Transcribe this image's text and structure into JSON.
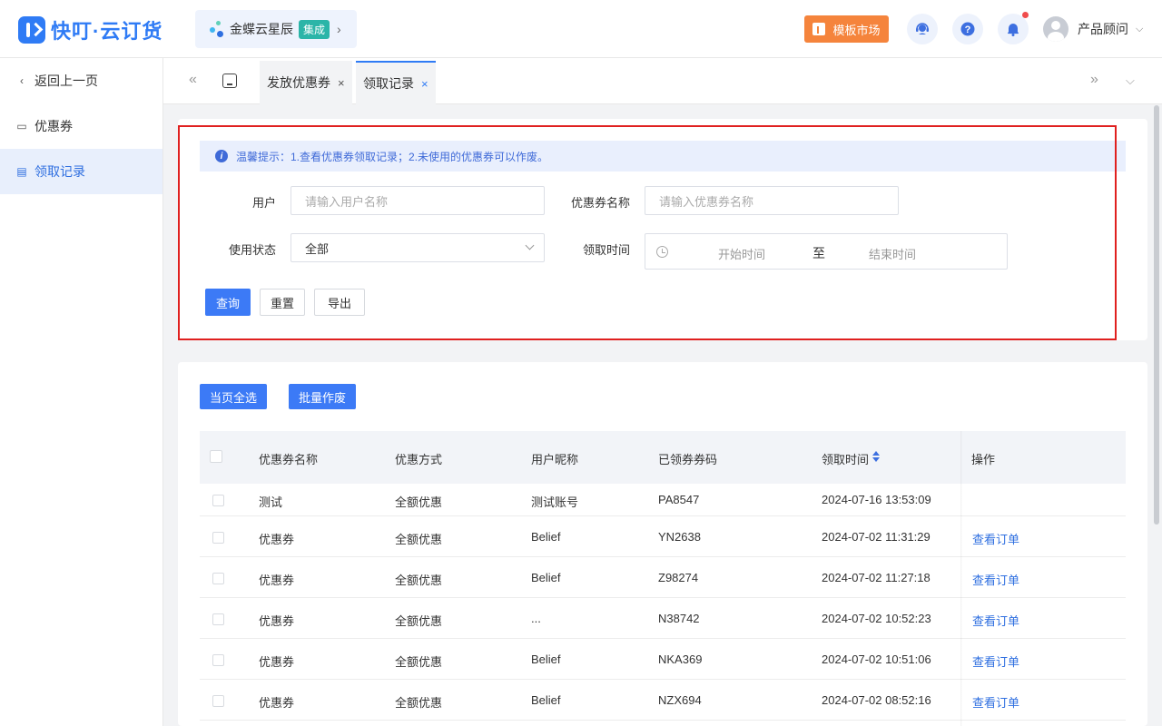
{
  "app": {
    "logo_text": "快叮·云订货"
  },
  "header": {
    "partner_name": "金蝶云星辰",
    "partner_tag": "集成",
    "partner_arrow": "›",
    "template_market": "模板市场",
    "user_name": "产品顾问",
    "user_caret": "⌵"
  },
  "sidebar": {
    "back": "返回上一页",
    "items": [
      {
        "label": "优惠券"
      },
      {
        "label": "领取记录"
      }
    ]
  },
  "tabs": {
    "items": [
      {
        "label": "发放优惠券",
        "close": "×"
      },
      {
        "label": "领取记录",
        "close": "×"
      }
    ]
  },
  "filter": {
    "tip": "温馨提示：1.查看优惠券领取记录；2.未使用的优惠券可以作废。",
    "user_label": "用户",
    "user_placeholder": "请输入用户名称",
    "coupon_label": "优惠券名称",
    "coupon_placeholder": "请输入优惠券名称",
    "status_label": "使用状态",
    "status_value": "全部",
    "time_label": "领取时间",
    "time_start": "开始时间",
    "time_sep": "至",
    "time_end": "结束时间",
    "query": "查询",
    "reset": "重置",
    "export": "导出"
  },
  "table_actions": {
    "select_page": "当页全选",
    "batch_void": "批量作废"
  },
  "table": {
    "columns": [
      "优惠券名称",
      "优惠方式",
      "用户昵称",
      "已领券券码",
      "领取时间",
      "操作"
    ],
    "rows": [
      {
        "name": "测试",
        "method": "全额优惠",
        "nickname": "测试账号",
        "code": "PA8547",
        "time": "2024-07-16 13:53:09",
        "action": ""
      },
      {
        "name": "优惠券",
        "method": "全额优惠",
        "nickname": "Belief",
        "code": "YN2638",
        "time": "2024-07-02 11:31:29",
        "action": "查看订单"
      },
      {
        "name": "优惠券",
        "method": "全额优惠",
        "nickname": "Belief",
        "code": "Z98274",
        "time": "2024-07-02 11:27:18",
        "action": "查看订单"
      },
      {
        "name": "优惠券",
        "method": "全额优惠",
        "nickname": "...",
        "code": "N38742",
        "time": "2024-07-02 10:52:23",
        "action": "查看订单"
      },
      {
        "name": "优惠券",
        "method": "全额优惠",
        "nickname": "Belief",
        "code": "NKA369",
        "time": "2024-07-02 10:51:06",
        "action": "查看订单"
      },
      {
        "name": "优惠券",
        "method": "全额优惠",
        "nickname": "Belief",
        "code": "NZX694",
        "time": "2024-07-02 08:52:16",
        "action": "查看订单"
      }
    ]
  },
  "colors": {
    "primary": "#3c7af6",
    "brand": "#2f7bf5",
    "template_button": "#f5843c",
    "highlight_border": "#e0201f",
    "link": "#2f6fe0"
  }
}
